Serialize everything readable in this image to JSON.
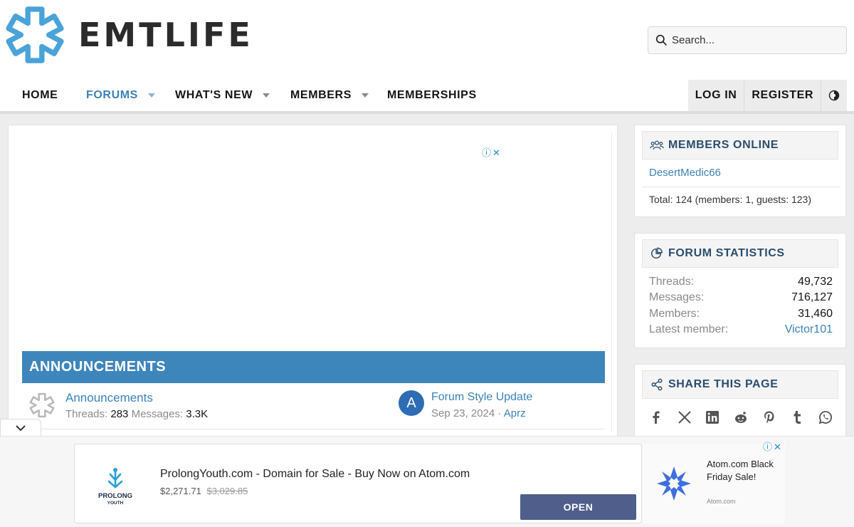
{
  "brand": {
    "name": "EMTLIFE",
    "accent": "#3b82b8",
    "header_bar": "#3d86bb"
  },
  "search": {
    "placeholder": "Search..."
  },
  "nav": {
    "items": [
      {
        "label": "HOME",
        "has_menu": false,
        "active": false
      },
      {
        "label": "FORUMS",
        "has_menu": true,
        "active": true
      },
      {
        "label": "WHAT'S NEW",
        "has_menu": true,
        "active": false
      },
      {
        "label": "MEMBERS",
        "has_menu": true,
        "active": false
      },
      {
        "label": "MEMBERSHIPS",
        "has_menu": false,
        "active": false
      }
    ],
    "login": "LOG IN",
    "register": "REGISTER",
    "theme_icon": "theme-toggle-icon"
  },
  "ad_top": {
    "marks": "ⓘ✕"
  },
  "category": {
    "title": "ANNOUNCEMENTS",
    "forum": {
      "title": "Announcements",
      "threads_label": "Threads:",
      "threads": "283",
      "messages_label": "Messages:",
      "messages": "3.3K",
      "latest": {
        "avatar_letter": "A",
        "title": "Forum Style Update",
        "date": "Sep 23, 2024",
        "separator": "·",
        "user": "Aprz"
      }
    }
  },
  "sidebar": {
    "members_online": {
      "title": "MEMBERS ONLINE",
      "users": [
        "DesertMedic66"
      ],
      "total": "Total: 124 (members: 1, guests: 123)"
    },
    "forum_statistics": {
      "title": "FORUM STATISTICS",
      "rows": [
        {
          "label": "Threads:",
          "value": "49,732"
        },
        {
          "label": "Messages:",
          "value": "716,127"
        },
        {
          "label": "Members:",
          "value": "31,460"
        },
        {
          "label": "Latest member:",
          "value": "Victor101"
        }
      ]
    },
    "share": {
      "title": "SHARE THIS PAGE",
      "icons": [
        "facebook-icon",
        "x-icon",
        "linkedin-icon",
        "reddit-icon",
        "pinterest-icon",
        "tumblr-icon",
        "whatsapp-icon"
      ]
    }
  },
  "bottom_ad": {
    "brand_line1": "PROLONG",
    "brand_line2": "YOUTH",
    "title": "ProlongYouth.com - Domain for Sale - Buy Now on Atom.com",
    "price": "$2,271.71",
    "old_price": "$3,029.85",
    "cta": "OPEN",
    "side_text": "Atom.com Black Friday Sale!",
    "side_small": "Atom.com",
    "marks": "ⓘ✕"
  }
}
